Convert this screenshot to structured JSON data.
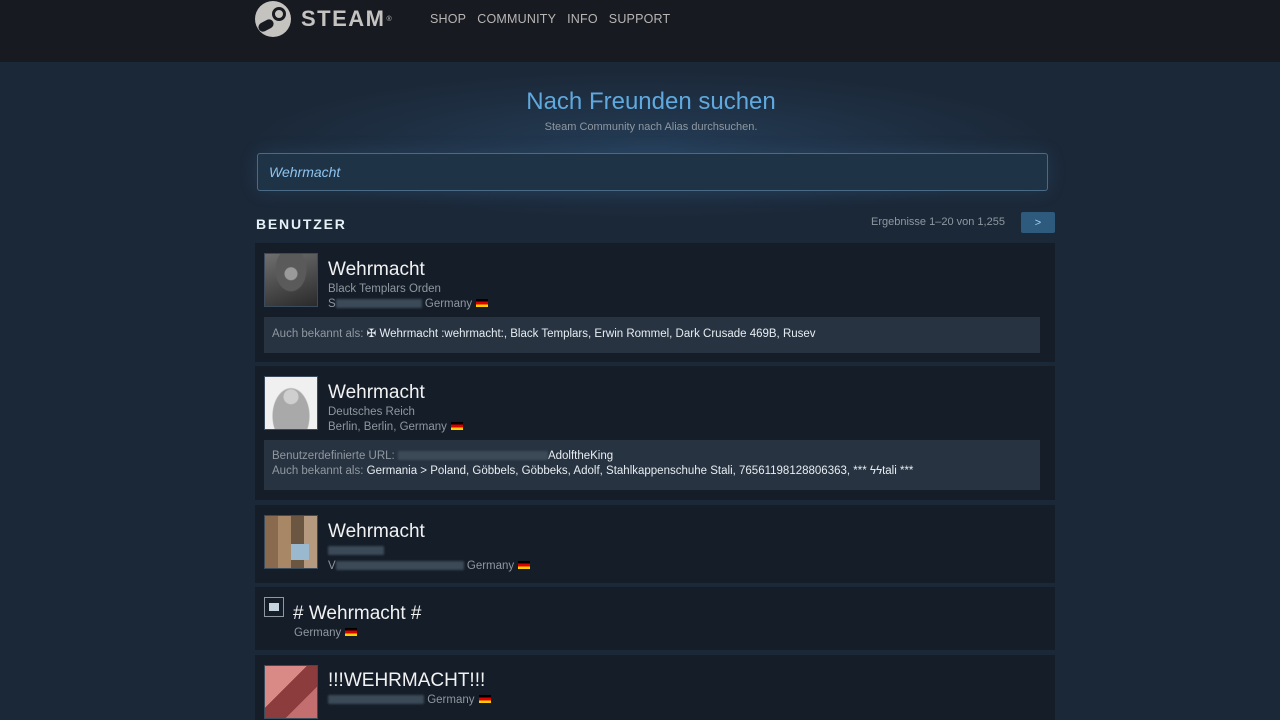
{
  "header": {
    "logo_text": "STEAM",
    "nav": [
      "SHOP",
      "COMMUNITY",
      "INFO",
      "SUPPORT"
    ]
  },
  "hero": {
    "title": "Nach Freunden suchen",
    "subtitle": "Steam Community nach Alias durchsuchen."
  },
  "search": {
    "value": "Wehrmacht"
  },
  "section": {
    "title": "BENUTZER",
    "results_text": "Ergebnisse 1–20 von 1,255",
    "next_label": ">"
  },
  "results": [
    {
      "name": "Wehrmacht",
      "line1": "Black Templars Orden",
      "location_prefix": "S",
      "location": "Germany",
      "aka_label": "Auch bekannt als: ",
      "aka_values": "✠ Wehrmacht :wehrmacht:, Black Templars, Erwin Rommel, Dark Crusade 469B, Rusev"
    },
    {
      "name": "Wehrmacht",
      "line1": "Deutsches Reich",
      "location": "Berlin, Berlin, Germany",
      "url_label": "Benutzerdefinierte URL: ",
      "url_value": "AdolftheKing",
      "aka_label": "Auch bekannt als: ",
      "aka_values": "Germania > Poland, Göbbels, Göbbeks, Adolf, Stahlkappenschuhe Stali, 76561198128806363, *** ϟϟtali ***"
    },
    {
      "name": "Wehrmacht",
      "location_prefix": "V",
      "location": "Germany"
    },
    {
      "name": "# Wehrmacht #",
      "location": "Germany"
    },
    {
      "name": "!!!WEHRMACHT!!!",
      "location": "Germany"
    }
  ],
  "colors": {
    "background": "#1b2838",
    "header": "#171a21",
    "title_blue": "#5fa9de",
    "card": "#141d28",
    "aka_box": "#283341"
  }
}
